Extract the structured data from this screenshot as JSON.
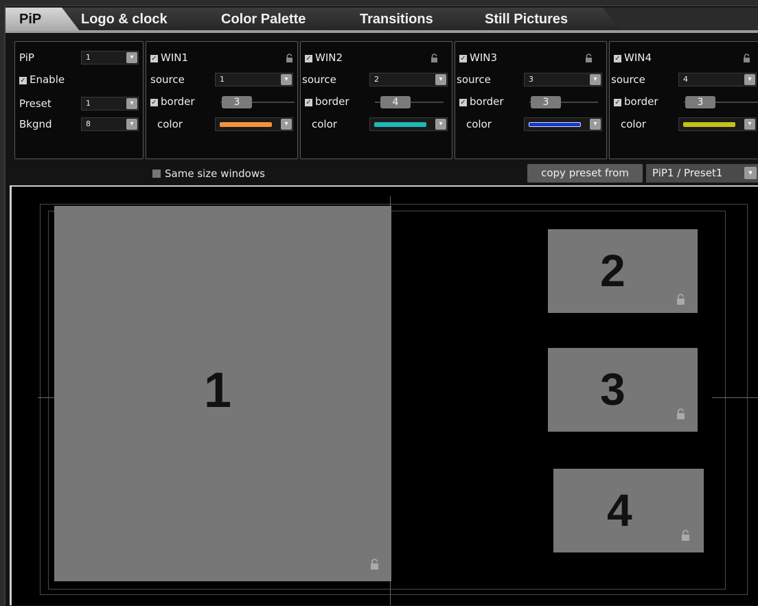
{
  "tabs": [
    "PiP",
    "Logo & clock",
    "Color Palette",
    "Transitions",
    "Still Pictures"
  ],
  "pip_panel": {
    "pip_label": "PiP",
    "pip_value": "1",
    "enable_label": "Enable",
    "preset_label": "Preset",
    "preset_value": "1",
    "bkgnd_label": "Bkgnd",
    "bkgnd_value": "8"
  },
  "windows": [
    {
      "title": "WIN1",
      "source_label": "source",
      "source": "1",
      "border_label": "border",
      "border": "3",
      "color_label": "color",
      "color": "#f5913c"
    },
    {
      "title": "WIN2",
      "source_label": "source",
      "source": "2",
      "border_label": "border",
      "border": "4",
      "color_label": "color",
      "color": "#1fb8b3"
    },
    {
      "title": "WIN3",
      "source_label": "source",
      "source": "3",
      "border_label": "border",
      "border": "3",
      "color_label": "color",
      "color": "#1438d8"
    },
    {
      "title": "WIN4",
      "source_label": "source",
      "source": "4",
      "border_label": "border",
      "border": "3",
      "color_label": "color",
      "color": "#c2c21a"
    }
  ],
  "same_size_label": "Same size windows",
  "copy_preset_label": "copy preset from",
  "copy_preset_value": "PiP1 / Preset1",
  "canvas_windows": [
    {
      "number": "1"
    },
    {
      "number": "2"
    },
    {
      "number": "3"
    },
    {
      "number": "4"
    }
  ]
}
